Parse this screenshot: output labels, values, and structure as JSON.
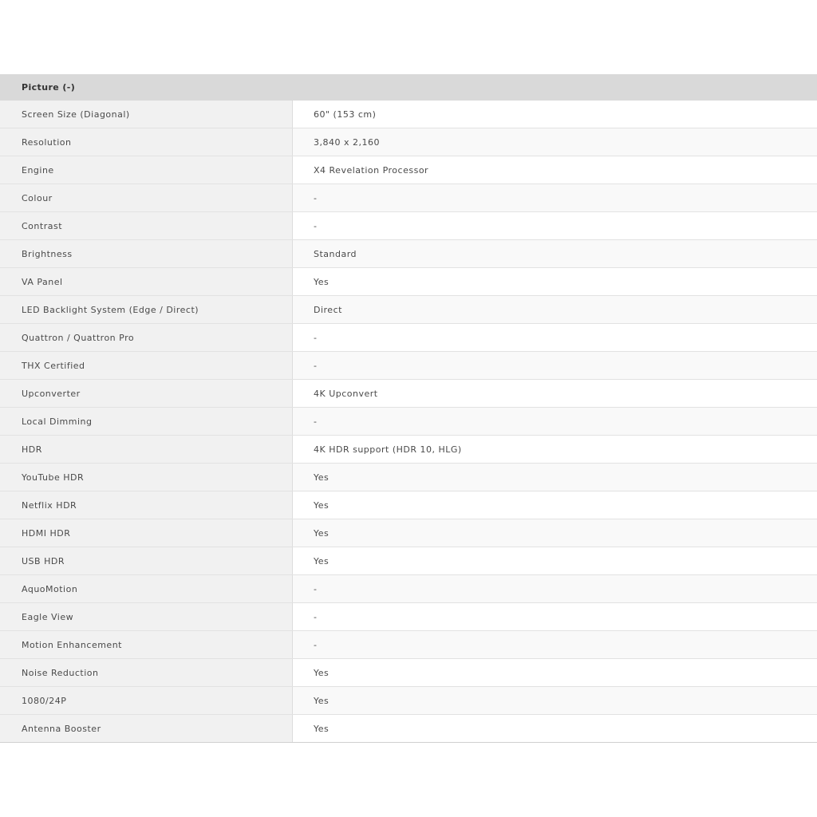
{
  "section": {
    "title": "Picture (-)"
  },
  "rows": [
    {
      "label": "Screen Size (Diagonal)",
      "value": "60\" (153 cm)"
    },
    {
      "label": "Resolution",
      "value": "3,840 x 2,160"
    },
    {
      "label": "Engine",
      "value": "X4 Revelation Processor"
    },
    {
      "label": "Colour",
      "value": "-"
    },
    {
      "label": "Contrast",
      "value": "-"
    },
    {
      "label": "Brightness",
      "value": "Standard"
    },
    {
      "label": "VA Panel",
      "value": "Yes"
    },
    {
      "label": "LED Backlight System (Edge / Direct)",
      "value": "Direct"
    },
    {
      "label": "Quattron / Quattron Pro",
      "value": "-"
    },
    {
      "label": "THX Certified",
      "value": "-"
    },
    {
      "label": "Upconverter",
      "value": "4K Upconvert"
    },
    {
      "label": "Local Dimming",
      "value": "-"
    },
    {
      "label": "HDR",
      "value": "4K HDR support (HDR 10, HLG)"
    },
    {
      "label": "YouTube HDR",
      "value": "Yes"
    },
    {
      "label": "Netflix HDR",
      "value": "Yes"
    },
    {
      "label": "HDMI HDR",
      "value": "Yes"
    },
    {
      "label": "USB HDR",
      "value": "Yes"
    },
    {
      "label": "AquoMotion",
      "value": "-"
    },
    {
      "label": "Eagle View",
      "value": "-"
    },
    {
      "label": "Motion Enhancement",
      "value": "-"
    },
    {
      "label": "Noise Reduction",
      "value": "Yes"
    },
    {
      "label": "1080/24P",
      "value": "Yes"
    },
    {
      "label": "Antenna Booster",
      "value": "Yes"
    }
  ]
}
